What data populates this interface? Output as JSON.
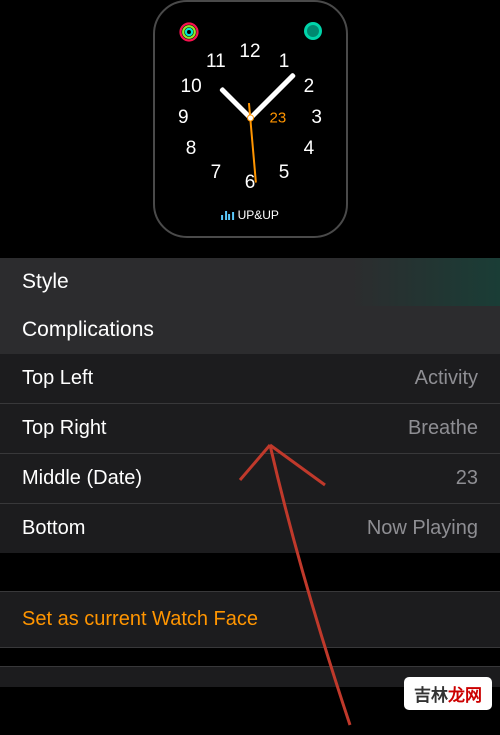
{
  "watch": {
    "date": "23",
    "now_playing": "UP&UP",
    "numbers": [
      "12",
      "1",
      "2",
      "3",
      "4",
      "5",
      "6",
      "7",
      "8",
      "9",
      "10",
      "11"
    ]
  },
  "sections": {
    "style": "Style",
    "complications": "Complications"
  },
  "rows": {
    "top_left": {
      "label": "Top Left",
      "value": "Activity"
    },
    "top_right": {
      "label": "Top Right",
      "value": "Breathe"
    },
    "middle": {
      "label": "Middle (Date)",
      "value": "23"
    },
    "bottom": {
      "label": "Bottom",
      "value": "Now Playing"
    }
  },
  "actions": {
    "set_face": "Set as current Watch Face",
    "remove": ""
  },
  "watermark": {
    "text1": "吉林",
    "text2": "龙网"
  }
}
